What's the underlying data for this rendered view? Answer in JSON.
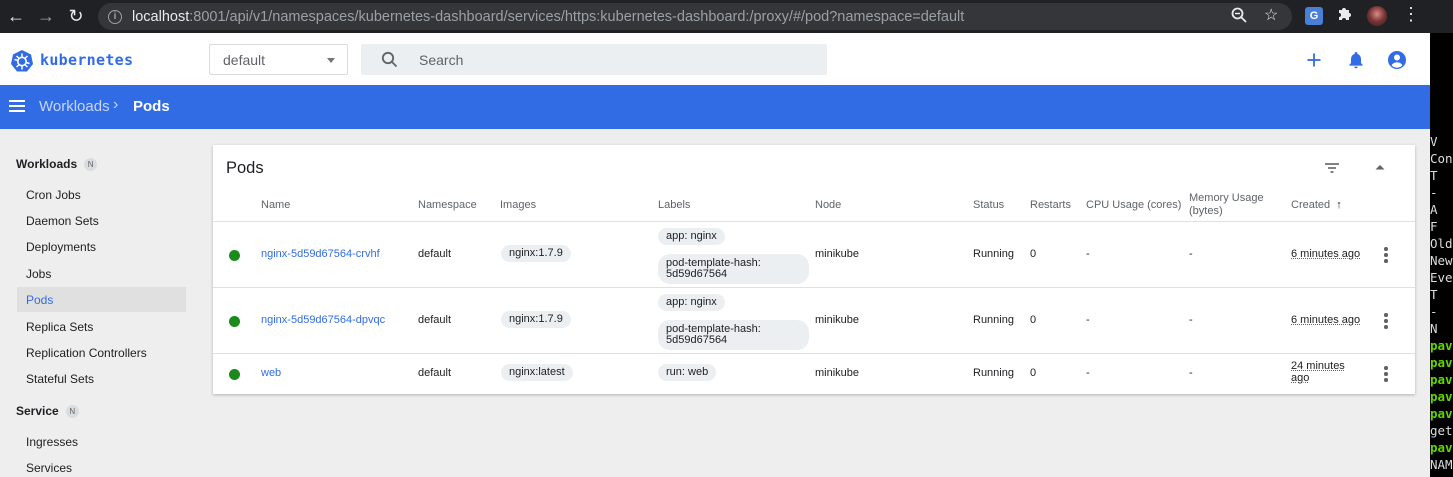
{
  "browser": {
    "url_host": "localhost",
    "url_rest": ":8001/api/v1/namespaces/kubernetes-dashboard/services/https:kubernetes-dashboard:/proxy/#/pod?namespace=default"
  },
  "header": {
    "logo_text": "kubernetes",
    "namespace": "default",
    "search_placeholder": "Search"
  },
  "toolbar": {
    "breadcrumb_parent": "Workloads",
    "breadcrumb_current": "Pods"
  },
  "sidebar": {
    "workloads_title": "Workloads",
    "workloads_badge": "N",
    "workloads_items": [
      "Cron Jobs",
      "Daemon Sets",
      "Deployments",
      "Jobs",
      "Pods",
      "Replica Sets",
      "Replication Controllers",
      "Stateful Sets"
    ],
    "service_title": "Service",
    "service_badge": "N",
    "service_items": [
      "Ingresses",
      "Services"
    ]
  },
  "pods": {
    "title": "Pods",
    "columns": {
      "name": "Name",
      "namespace": "Namespace",
      "images": "Images",
      "labels": "Labels",
      "node": "Node",
      "status": "Status",
      "restarts": "Restarts",
      "cpu": "CPU Usage (cores)",
      "memory_line1": "Memory Usage",
      "memory_line2": "(bytes)",
      "created": "Created",
      "sort_arrow": "↑"
    },
    "rows": [
      {
        "name": "nginx-5d59d67564-crvhf",
        "namespace": "default",
        "image": "nginx:1.7.9",
        "label1": "app: nginx",
        "label2": "pod-template-hash: 5d59d67564",
        "node": "minikube",
        "status": "Running",
        "restarts": "0",
        "cpu": "-",
        "memory": "-",
        "created": "6 minutes ago"
      },
      {
        "name": "nginx-5d59d67564-dpvqc",
        "namespace": "default",
        "image": "nginx:1.7.9",
        "label1": "app: nginx",
        "label2": "pod-template-hash: 5d59d67564",
        "node": "minikube",
        "status": "Running",
        "restarts": "0",
        "cpu": "-",
        "memory": "-",
        "created": "6 minutes ago"
      },
      {
        "name": "web",
        "namespace": "default",
        "image": "nginx:latest",
        "label1": "run: web",
        "node": "minikube",
        "status": "Running",
        "restarts": "0",
        "cpu": "-",
        "memory": "-",
        "created_line1": "24 minutes",
        "created_line2": "ago"
      }
    ]
  },
  "terminal": {
    "lines": [
      {
        "text": " V",
        "green": false
      },
      {
        "text": "Con",
        "green": false
      },
      {
        "text": "  T",
        "green": false
      },
      {
        "text": "  -",
        "green": false
      },
      {
        "text": "  A",
        "green": false
      },
      {
        "text": "  F",
        "green": false
      },
      {
        "text": "Old",
        "green": false
      },
      {
        "text": "New",
        "green": false
      },
      {
        "text": "Eve",
        "green": false
      },
      {
        "text": "  T",
        "green": false
      },
      {
        "text": "  -",
        "green": false
      },
      {
        "text": "  N",
        "green": false
      },
      {
        "text": "pav",
        "green": true
      },
      {
        "text": "pav",
        "green": true
      },
      {
        "text": "pav",
        "green": true
      },
      {
        "text": "pav",
        "green": true
      },
      {
        "text": "pav",
        "green": true
      },
      {
        "text": "get",
        "green": false
      },
      {
        "text": "pav",
        "green": true
      },
      {
        "text": "NAM",
        "green": false
      }
    ]
  },
  "colors": {
    "brand": "#326ce5",
    "running": "#1b8a1b"
  }
}
